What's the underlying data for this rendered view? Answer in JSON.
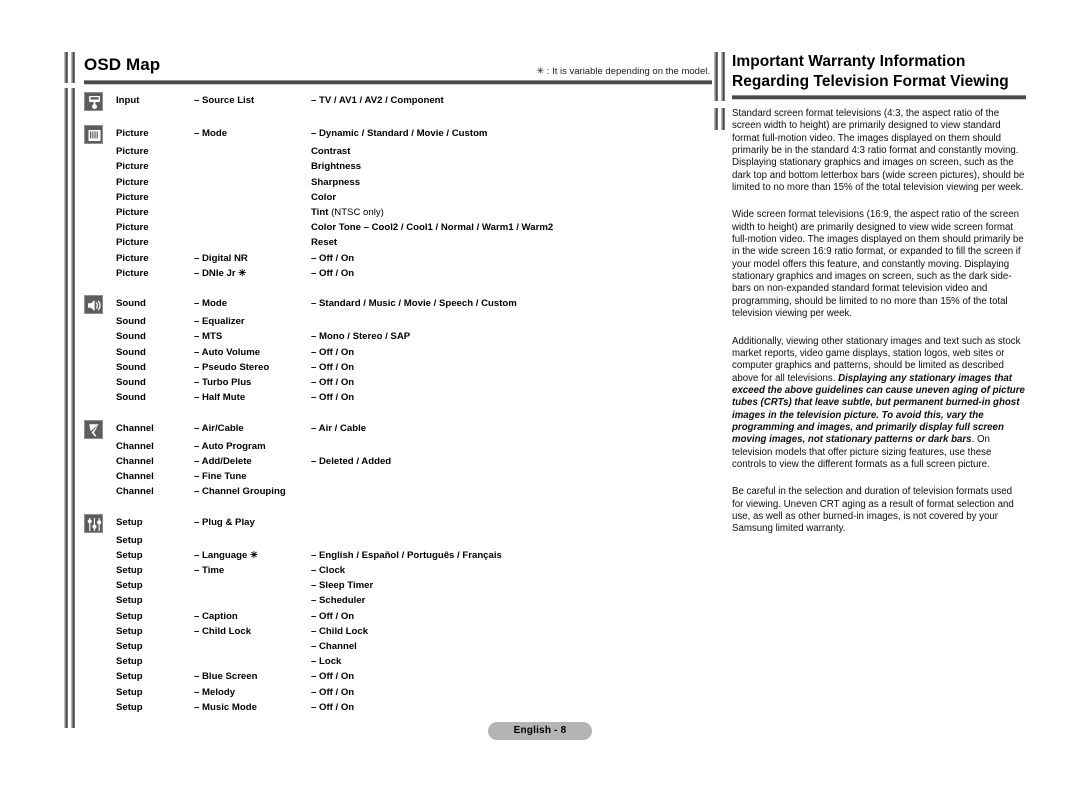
{
  "left_panel": {
    "title": "OSD Map",
    "note": "✳ : It is variable depending on the model.",
    "sections": [
      {
        "icon": "remote-control-icon",
        "category": "Input",
        "rows": [
          {
            "level2": "– Source List",
            "level3": "– TV / AV1 / AV2 / Component"
          }
        ]
      },
      {
        "icon": "picture-icon",
        "category": "Picture",
        "rows": [
          {
            "level2": "– Mode",
            "level3": "– Dynamic / Standard / Movie / Custom"
          },
          {
            "level2": "",
            "level3": "Contrast"
          },
          {
            "level2": "",
            "level3": "Brightness"
          },
          {
            "level2": "",
            "level3": "Sharpness"
          },
          {
            "level2": "",
            "level3": "Color"
          },
          {
            "level2": "",
            "level3": "Tint ",
            "level3_thin": "(NTSC only)"
          },
          {
            "level2": "",
            "level3": "Color Tone – Cool2 / Cool1 / Normal / Warm1 / Warm2"
          },
          {
            "level2": "",
            "level3": "Reset"
          },
          {
            "level2": "– Digital NR",
            "level3": "– Off / On"
          },
          {
            "level2": "– DNIe Jr ✳",
            "level3": "– Off / On"
          }
        ]
      },
      {
        "icon": "speaker-icon",
        "category": "Sound",
        "rows": [
          {
            "level2": "– Mode",
            "level3": "– Standard / Music / Movie / Speech / Custom"
          },
          {
            "level2": "– Equalizer",
            "level3": ""
          },
          {
            "level2": "– MTS",
            "level3": "– Mono / Stereo / SAP"
          },
          {
            "level2": "– Auto Volume",
            "level3": "– Off / On"
          },
          {
            "level2": "– Pseudo Stereo",
            "level3": "– Off / On"
          },
          {
            "level2": "– Turbo Plus",
            "level3": "– Off / On"
          },
          {
            "level2": "– Half Mute",
            "level3": "– Off / On"
          }
        ]
      },
      {
        "icon": "antenna-icon",
        "category": "Channel",
        "rows": [
          {
            "level2": "– Air/Cable",
            "level3": "– Air / Cable"
          },
          {
            "level2": "– Auto Program",
            "level3": ""
          },
          {
            "level2": "– Add/Delete",
            "level3": "– Deleted / Added"
          },
          {
            "level2": "– Fine Tune",
            "level3": ""
          },
          {
            "level2": "– Channel  Grouping",
            "level3": ""
          }
        ]
      },
      {
        "icon": "sliders-icon",
        "category": "Setup",
        "rows": [
          {
            "level2": "– Plug & Play",
            "level3": ""
          },
          {
            "level2": "",
            "level3": ""
          },
          {
            "level2": "– Language ✳",
            "level3": "– English / Español / Português / Français"
          },
          {
            "level2": "– Time",
            "level3": "– Clock"
          },
          {
            "level2": "",
            "level3": "– Sleep Timer"
          },
          {
            "level2": "",
            "level3": "– Scheduler"
          },
          {
            "level2": "– Caption",
            "level3": "– Off / On"
          },
          {
            "level2": "– Child Lock",
            "level3": "– Child Lock"
          },
          {
            "level2": "",
            "level3": "– Channel"
          },
          {
            "level2": "",
            "level3": "– Lock"
          },
          {
            "level2": "– Blue Screen",
            "level3": "– Off / On"
          },
          {
            "level2": "– Melody",
            "level3": "– Off / On"
          },
          {
            "level2": "– Music Mode",
            "level3": "– Off / On"
          }
        ]
      }
    ]
  },
  "right_panel": {
    "title_line1": "Important Warranty Information",
    "title_line2": "Regarding Television Format Viewing",
    "paragraphs": [
      {
        "parts": [
          {
            "style": "normal",
            "text": "Standard screen format televisions (4:3, the aspect ratio of the screen width to height) are primarily designed to view standard format full-motion video. The images displayed on them should primarily be in the standard 4:3 ratio format and constantly moving. Displaying stationary graphics and images on screen, such as the dark top and bottom letterbox bars (wide screen pictures), should be limited to no more than 15% of the total television viewing per week."
          }
        ]
      },
      {
        "parts": [
          {
            "style": "normal",
            "text": "Wide screen format televisions (16:9, the aspect ratio of the screen width to height) are primarily designed to view wide screen format full-motion video. The images displayed on them should primarily be in the wide screen 16:9 ratio format, or expanded to fill the screen if your model offers this feature, and constantly moving. Displaying stationary graphics and images on screen, such as the dark side-bars on non-expanded standard format television video and programming, should be limited to no more than 15% of the total television viewing per week."
          }
        ]
      },
      {
        "parts": [
          {
            "style": "normal",
            "text": "Additionally, viewing other stationary images and text such as stock market reports, video game displays, station logos, web sites or computer graphics and patterns, should be limited as described above for all televisions. "
          },
          {
            "style": "em",
            "text": "Displaying any stationary images that exceed the above guidelines can cause uneven aging of picture tubes (CRTs) that leave subtle, but permanent burned-in ghost images in the television picture. To avoid this, vary the programming and images, and primarily display full screen moving images, not stationary patterns or dark bars"
          },
          {
            "style": "normal",
            "text": ". On television models that offer picture sizing features, use these controls to view the different formats as a full screen picture."
          }
        ]
      },
      {
        "parts": [
          {
            "style": "normal",
            "text": "Be careful in the selection and duration of television formats used for viewing. Uneven CRT aging as a result of format selection and use, as well as other burned-in images, is not covered by your Samsung limited warranty."
          }
        ]
      }
    ]
  },
  "footer": {
    "page_label": "English - 8"
  },
  "colors": {
    "icon_tile_fill": "#5d5d5d",
    "icon_tile_border": "#8e8e8e",
    "rule": "#4a4a4a",
    "page_pill": "#b4b4b4"
  }
}
